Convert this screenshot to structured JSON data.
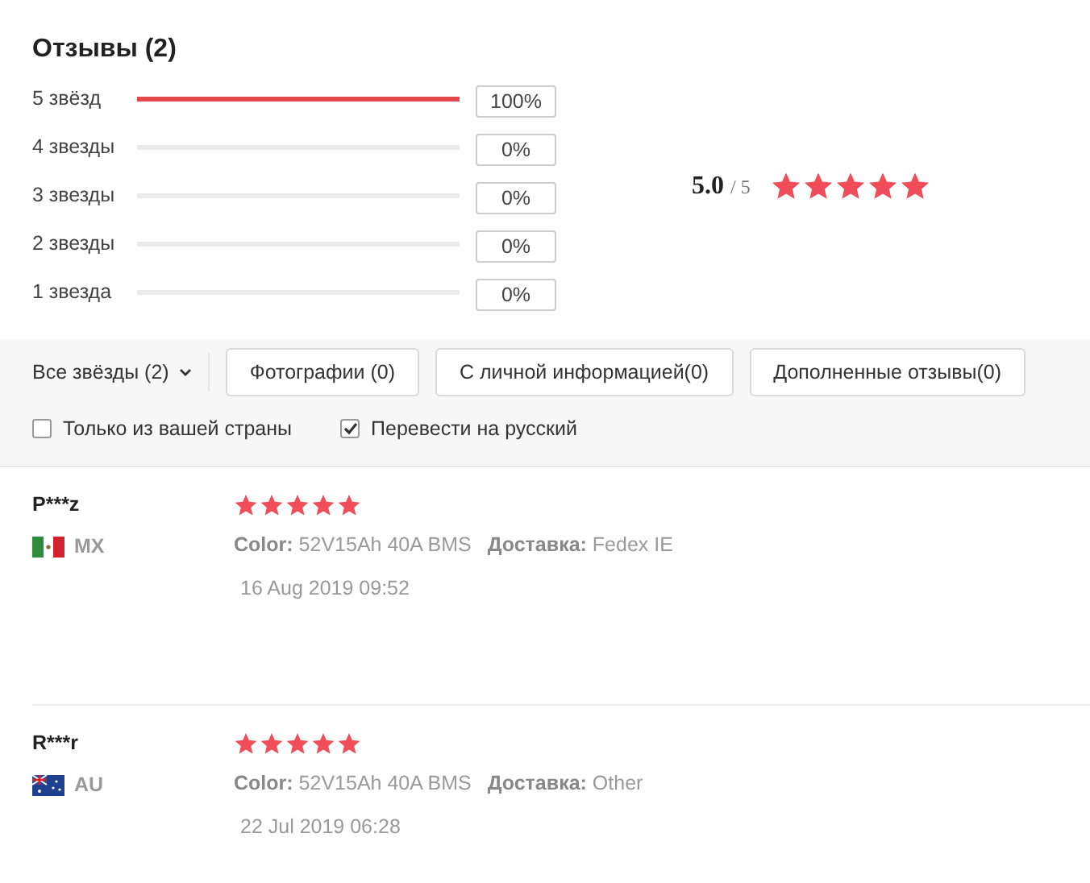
{
  "title": "Отзывы (2)",
  "distribution": [
    {
      "label": "5 звёзд",
      "level": 1,
      "percent": "100%"
    },
    {
      "label": "4 звезды",
      "level": 0,
      "percent": "0%"
    },
    {
      "label": "3 звезды",
      "level": 0,
      "percent": "0%"
    },
    {
      "label": "2 звезды",
      "level": 0,
      "percent": "0%"
    },
    {
      "label": "1 звезда",
      "level": 0,
      "percent": "0%"
    }
  ],
  "summary": {
    "score": "5.0",
    "out_of": "/ 5",
    "stars": 5
  },
  "filters": {
    "dropdown": "Все звёзды (2)",
    "buttons": [
      "Фотографии (0)",
      "С личной информацией(0)",
      "Дополненные отзывы(0)"
    ]
  },
  "options": [
    {
      "label": "Только из вашей страны",
      "checked": false
    },
    {
      "label": "Перевести на русский",
      "checked": true
    }
  ],
  "reviews": [
    {
      "name": "P***z",
      "flag": {
        "kind": "mexico"
      },
      "country": "MX",
      "stars": 5,
      "variant_label": "Color:",
      "variant": "52V15Ah 40A BMS",
      "shipping_label": "Доставка:",
      "shipping": "Fedex IE",
      "date": "16 Aug 2019 09:52"
    },
    {
      "name": "R***r",
      "flag": {
        "kind": "australia"
      },
      "country": "AU",
      "stars": 5,
      "variant_label": "Color:",
      "variant": "52V15Ah 40A BMS",
      "shipping_label": "Доставка:",
      "shipping": "Other",
      "date": "22 Jul 2019 06:28"
    }
  ]
}
